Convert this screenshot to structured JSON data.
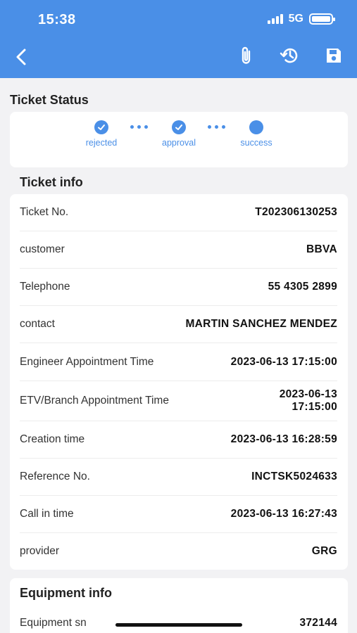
{
  "status_bar": {
    "time": "15:38",
    "network": "5G"
  },
  "nav": {
    "icons": [
      "back-icon",
      "paperclip-icon",
      "history-icon",
      "save-icon"
    ]
  },
  "ticket_status": {
    "title": "Ticket Status",
    "steps": [
      {
        "label": "rejected",
        "state": "done"
      },
      {
        "label": "approval",
        "state": "done"
      },
      {
        "label": "success",
        "state": "current"
      }
    ]
  },
  "ticket_info": {
    "title": "Ticket info",
    "rows": [
      {
        "key": "Ticket No.",
        "value": "T202306130253"
      },
      {
        "key": "customer",
        "value": "BBVA"
      },
      {
        "key": "Telephone",
        "value": "55 4305 2899"
      },
      {
        "key": "contact",
        "value": "MARTIN SANCHEZ MENDEZ"
      },
      {
        "key": "Engineer Appointment Time",
        "value": "2023-06-13 17:15:00"
      },
      {
        "key": "ETV/Branch Appointment Time",
        "value": "2023-06-13\n17:15:00"
      },
      {
        "key": "Creation time",
        "value": "2023-06-13 16:28:59"
      },
      {
        "key": "Reference No.",
        "value": "INCTSK5024633"
      },
      {
        "key": "Call in time",
        "value": "2023-06-13 16:27:43"
      },
      {
        "key": "provider",
        "value": "GRG"
      }
    ]
  },
  "equipment_info": {
    "title": "Equipment info",
    "rows": [
      {
        "key": "Equipment sn",
        "value": "372144"
      }
    ]
  },
  "colors": {
    "primary": "#4a8fe7",
    "background": "#f2f2f4",
    "card": "#ffffff"
  }
}
